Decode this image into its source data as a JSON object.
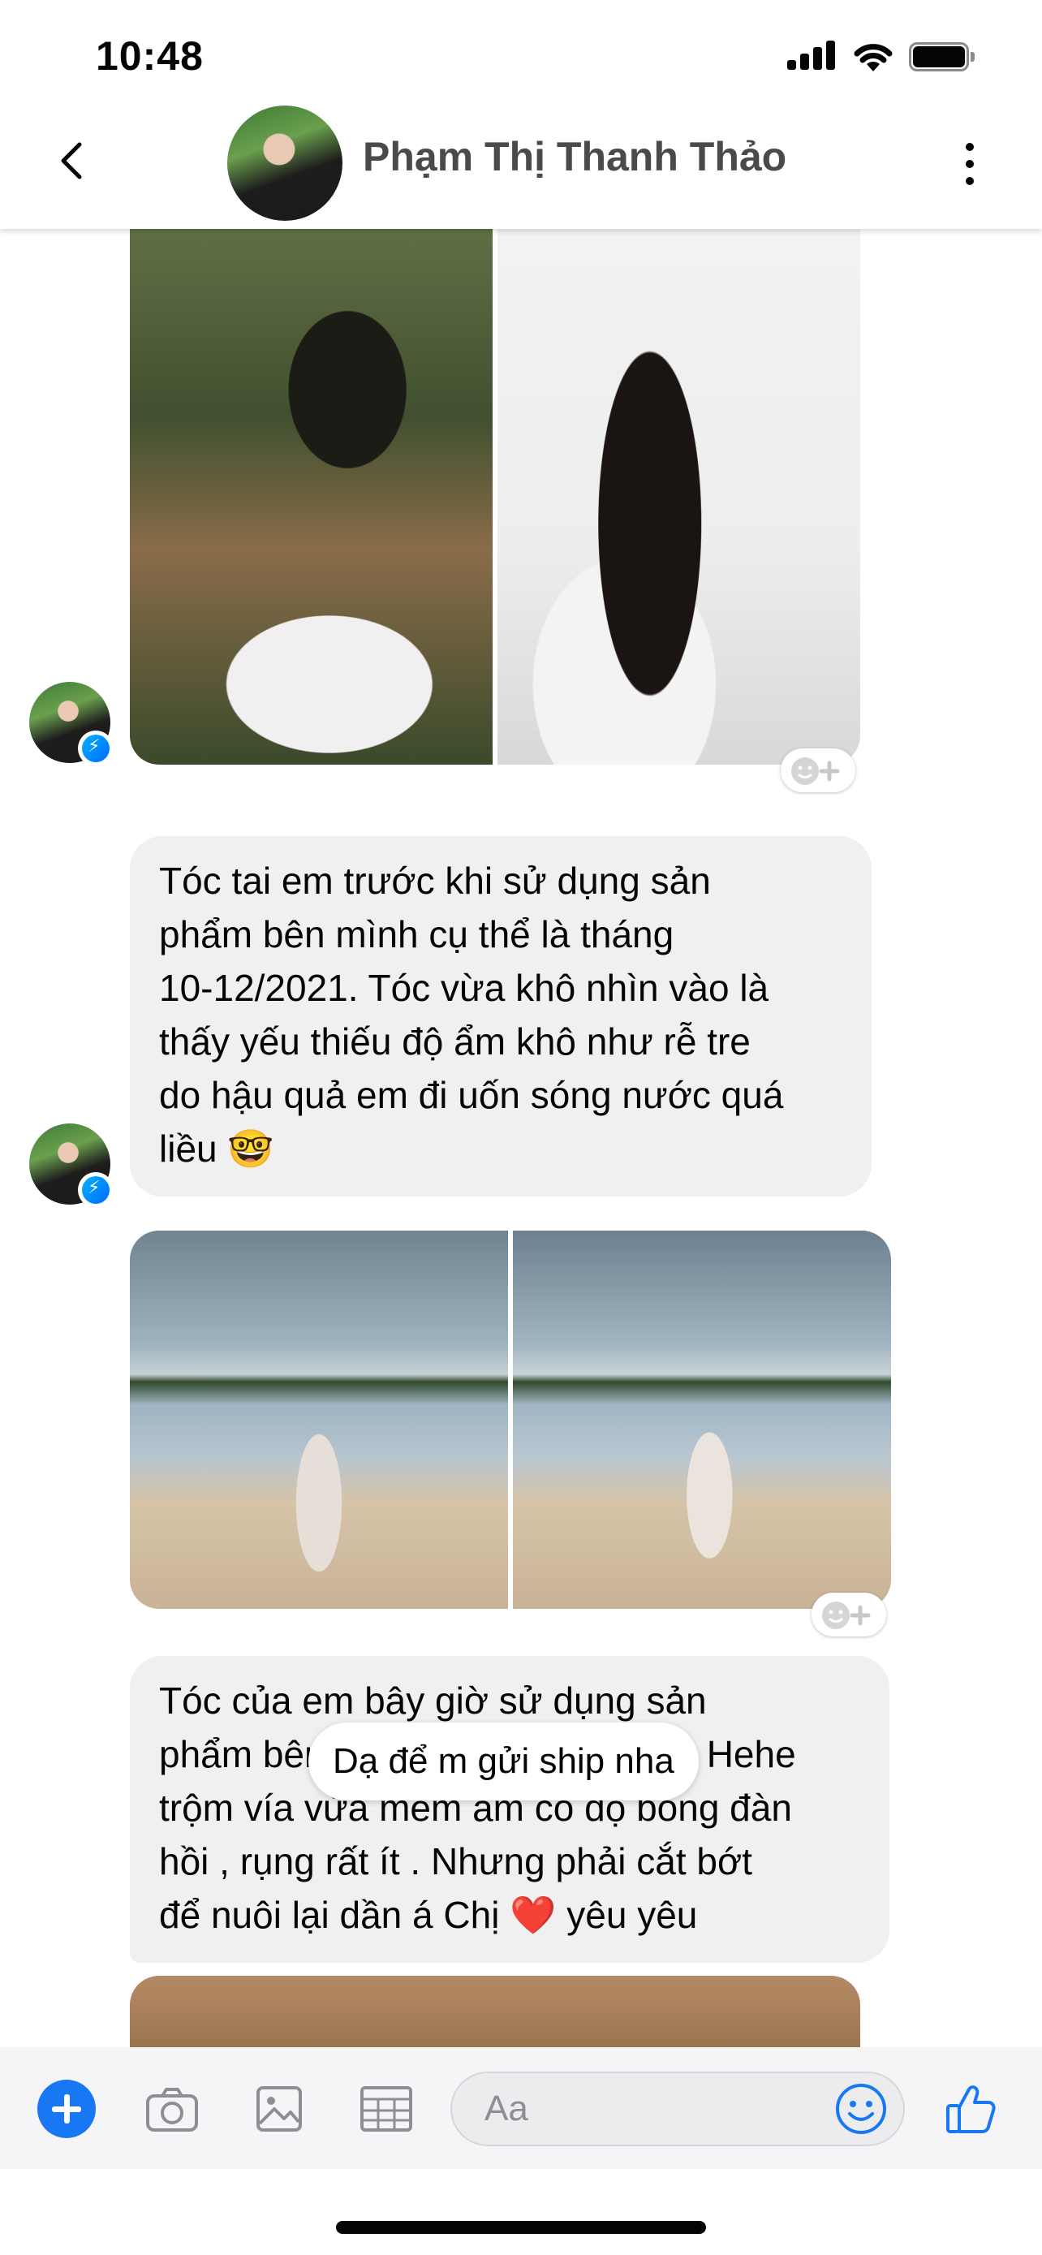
{
  "status_bar": {
    "time": "10:48",
    "icons": [
      "signal-icon",
      "wifi-icon",
      "battery-icon"
    ]
  },
  "header": {
    "contact_name": "Phạm Thị Thanh Thảo",
    "back_icon": "chevron-left-icon",
    "more_icon": "more-vertical-icon"
  },
  "messages": [
    {
      "type": "photos",
      "from": "contact",
      "photos": [
        "hair-before-back",
        "hair-before-ponytail"
      ]
    },
    {
      "type": "text",
      "from": "contact",
      "lines": [
        "Tóc tai em trước khi sử dụng sản",
        "phẩm bên mình cụ thể là tháng",
        "10-12/2021. Tóc vừa khô nhìn vào là",
        "thấy yếu thiếu độ ẩm khô như rễ tre",
        "do hậu quả em đi uốn sóng nước quá",
        "liều"
      ],
      "emoji": "🤓"
    },
    {
      "type": "photos",
      "from": "contact",
      "photos": [
        "lake-bridge-walking",
        "lake-bridge-holding-hands"
      ]
    },
    {
      "type": "text",
      "from": "contact",
      "lines": [
        "Tóc của em bây giờ sử dụng sản",
        "phẩm bên Chị được 6 tháng đây Hehe",
        "trộm vía vừa mềm ẩm có độ bóng đàn",
        "hồi , rụng rất ít . Nhưng phải cắt bớt",
        "để nuôi lại dần á Chị"
      ],
      "emoji": "❤️",
      "tail": "yêu yêu"
    },
    {
      "type": "photos",
      "from": "contact",
      "photos": [
        "wooden-background-partial"
      ]
    }
  ],
  "outgoing_preview": "Dạ để m gửi ship nha",
  "composer": {
    "placeholder": "Aa",
    "icons": [
      "plus-icon",
      "camera-icon",
      "gallery-icon",
      "grid-icon",
      "emoji-icon",
      "thumbs-up-icon"
    ]
  },
  "colors": {
    "accent": "#1877f2",
    "bubble": "#f0f0f0",
    "heart": "#e0245e"
  }
}
